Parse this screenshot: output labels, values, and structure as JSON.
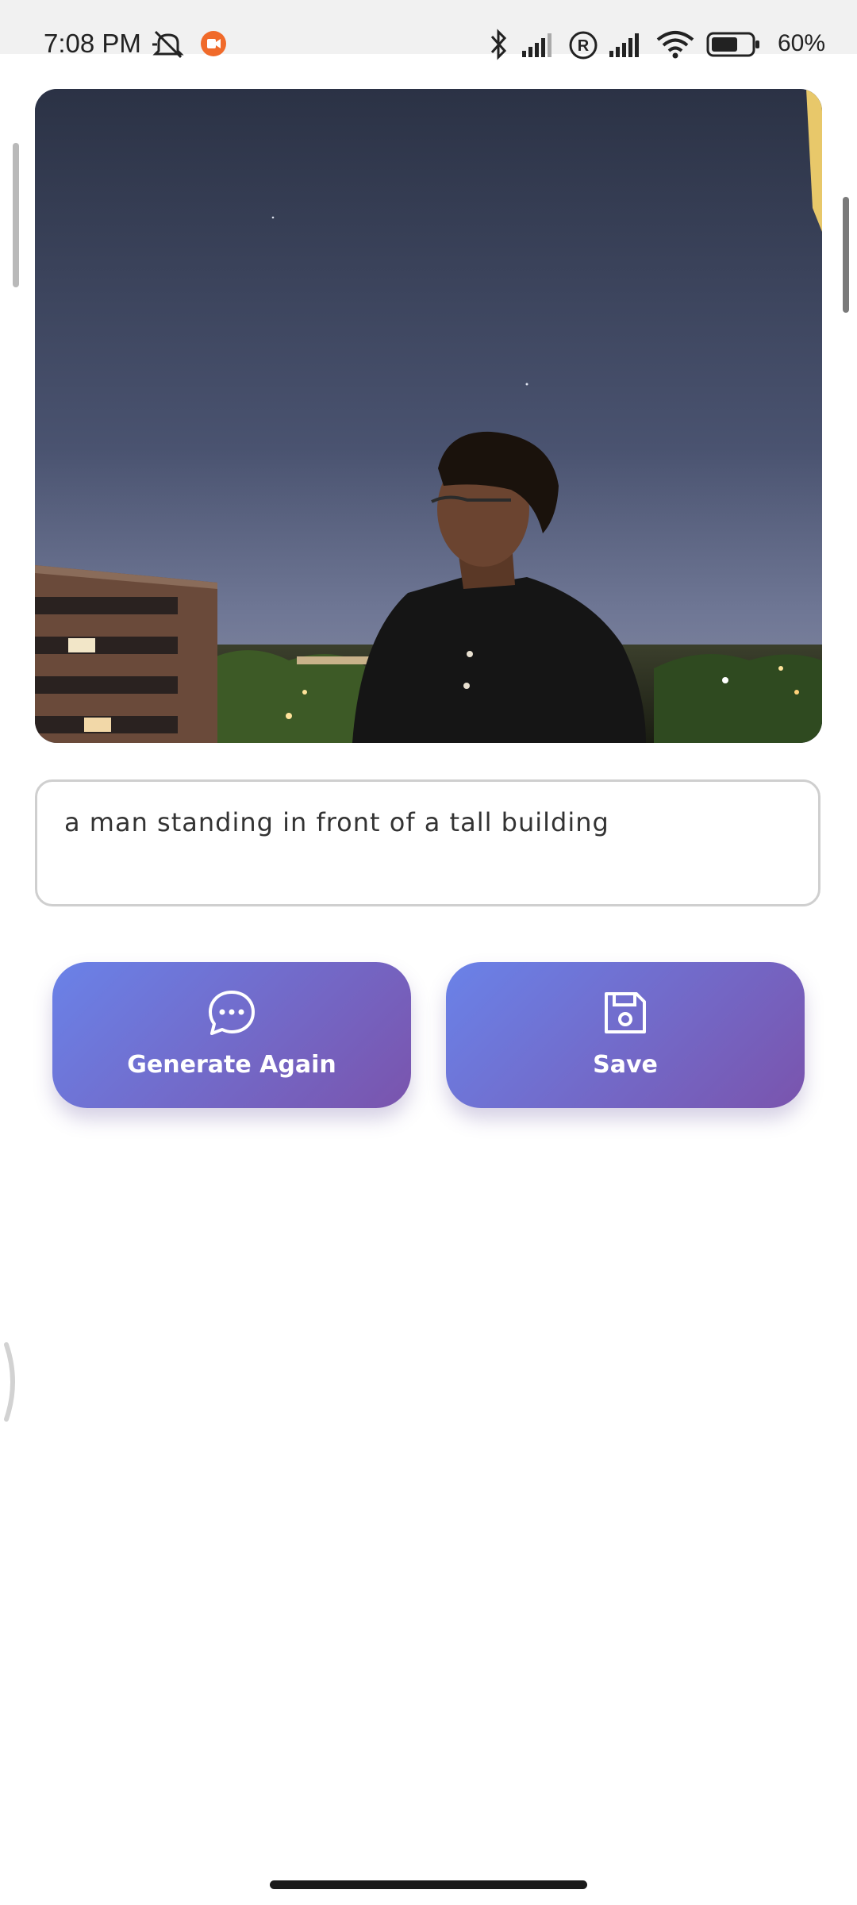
{
  "status_bar": {
    "time": "7:08 PM",
    "battery": "60%",
    "icons": [
      "mute-icon",
      "screen-record-icon",
      "bluetooth-icon",
      "signal-icon",
      "roaming-icon",
      "signal-icon",
      "wifi-icon",
      "battery-icon"
    ],
    "record_color": "#f06a2a"
  },
  "photo": {
    "subject": "image"
  },
  "caption": {
    "text": "a man standing in front of a tall building"
  },
  "actions": {
    "generate_again_label": "Generate Again",
    "generate_again_icon": "chat-bubble-icon",
    "save_label": "Save",
    "save_icon": "floppy-disk-icon"
  },
  "colors": {
    "button_gradient_start": "#6a82e8",
    "button_gradient_end": "#7a54ad"
  }
}
